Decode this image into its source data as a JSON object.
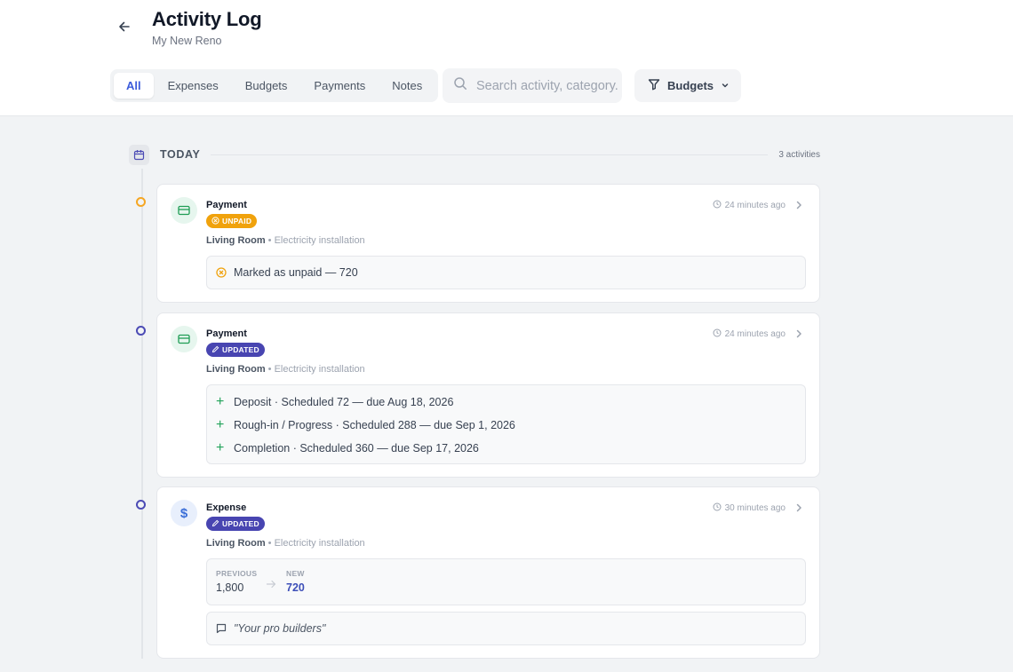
{
  "header": {
    "title": "Activity Log",
    "subtitle": "My New Reno"
  },
  "tabs": [
    {
      "label": "All",
      "active": true
    },
    {
      "label": "Expenses",
      "active": false
    },
    {
      "label": "Budgets",
      "active": false
    },
    {
      "label": "Payments",
      "active": false
    },
    {
      "label": "Notes",
      "active": false
    }
  ],
  "search": {
    "placeholder": "Search activity, category..."
  },
  "filter": {
    "label": "Budgets"
  },
  "day_group": {
    "label": "TODAY",
    "count": "3 activities"
  },
  "activities": [
    {
      "type": "Payment",
      "badge": "UNPAID",
      "location": "Living Room",
      "category": "• Electricity installation",
      "time": "24 minutes ago",
      "detail": "Marked as unpaid — 720"
    },
    {
      "type": "Payment",
      "badge": "UPDATED",
      "location": "Living Room",
      "category": "• Electricity installation",
      "time": "24 minutes ago",
      "items": [
        "Deposit · Scheduled 72 — due Aug 18, 2026",
        "Rough-in / Progress · Scheduled 288 — due Sep 1, 2026",
        "Completion · Scheduled 360 — due Sep 17, 2026"
      ]
    },
    {
      "type": "Expense",
      "badge": "UPDATED",
      "icon_symbol": "$",
      "location": "Living Room",
      "category": "• Electricity installation",
      "time": "30 minutes ago",
      "change": {
        "previous_label": "PREVIOUS",
        "previous_value": "1,800",
        "new_label": "NEW",
        "new_value": "720"
      },
      "note": "\"Your pro builders\""
    }
  ],
  "colors": {
    "accent": "#3b5bdb",
    "unpaid": "#f0a20c",
    "updated": "#4845b1",
    "added": "#22a35a"
  }
}
